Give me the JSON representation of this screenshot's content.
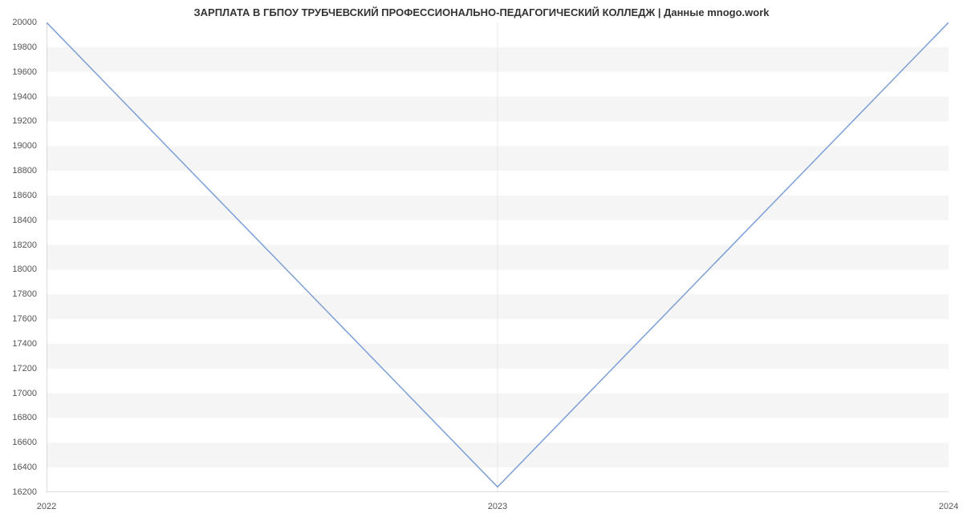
{
  "chart_data": {
    "type": "line",
    "title": "ЗАРПЛАТА В ГБПОУ ТРУБЧЕВСКИЙ ПРОФЕССИОНАЛЬНО-ПЕДАГОГИЧЕСКИЙ КОЛЛЕДЖ | Данные mnogo.work",
    "x": [
      "2022",
      "2023",
      "2024"
    ],
    "values": [
      20000,
      16242,
      20000
    ],
    "xlabel": "",
    "ylabel": "",
    "ylim": [
      16200,
      20000
    ],
    "yticks": [
      16200,
      16400,
      16600,
      16800,
      17000,
      17200,
      17400,
      17600,
      17800,
      18000,
      18200,
      18400,
      18600,
      18800,
      19000,
      19200,
      19400,
      19600,
      19800,
      20000
    ],
    "xticks": [
      "2022",
      "2023",
      "2024"
    ],
    "line_color": "#7b9fd6",
    "grid_band_color": "#f5f5f5"
  }
}
